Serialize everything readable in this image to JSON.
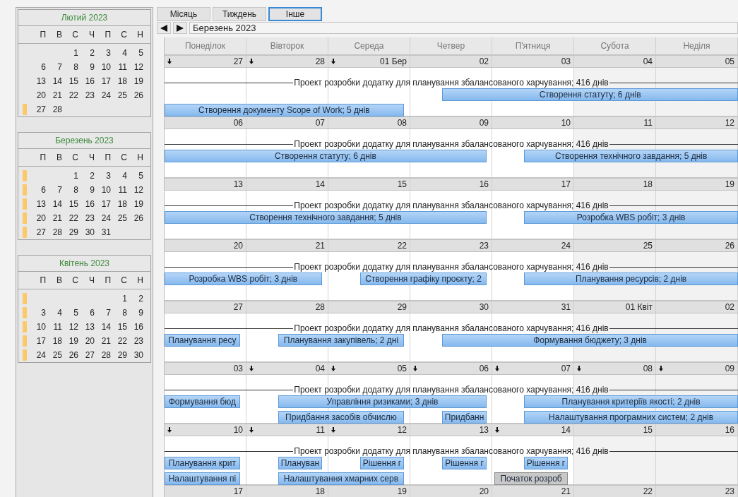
{
  "view_tabs": [
    {
      "label": "Місяць",
      "selected": false
    },
    {
      "label": "Тиждень",
      "selected": false
    },
    {
      "label": "Інше",
      "selected": true
    }
  ],
  "nav": {
    "title": "Березень 2023"
  },
  "mini_calendars": [
    {
      "title": "Лютий 2023",
      "weekdays": [
        "П",
        "В",
        "С",
        "Ч",
        "П",
        "С",
        "Н"
      ],
      "weeks": [
        {
          "marked": false,
          "days": [
            "1",
            "2",
            "3",
            "4",
            "5"
          ]
        },
        {
          "marked": false,
          "days": [
            "6",
            "7",
            "8",
            "9",
            "10",
            "11",
            "12"
          ]
        },
        {
          "marked": false,
          "days": [
            "13",
            "14",
            "15",
            "16",
            "17",
            "18",
            "19"
          ]
        },
        {
          "marked": false,
          "days": [
            "20",
            "21",
            "22",
            "23",
            "24",
            "25",
            "26"
          ]
        },
        {
          "marked": true,
          "days": [
            "27",
            "28"
          ]
        }
      ]
    },
    {
      "title": "Березень 2023",
      "weekdays": [
        "П",
        "В",
        "С",
        "Ч",
        "П",
        "С",
        "Н"
      ],
      "weeks": [
        {
          "marked": true,
          "days": [
            "1",
            "2",
            "3",
            "4",
            "5"
          ]
        },
        {
          "marked": true,
          "days": [
            "6",
            "7",
            "8",
            "9",
            "10",
            "11",
            "12"
          ]
        },
        {
          "marked": true,
          "days": [
            "13",
            "14",
            "15",
            "16",
            "17",
            "18",
            "19"
          ]
        },
        {
          "marked": true,
          "days": [
            "20",
            "21",
            "22",
            "23",
            "24",
            "25",
            "26"
          ]
        },
        {
          "marked": true,
          "days": [
            "27",
            "28",
            "29",
            "30",
            "31"
          ]
        }
      ]
    },
    {
      "title": "Квітень 2023",
      "weekdays": [
        "П",
        "В",
        "С",
        "Ч",
        "П",
        "С",
        "Н"
      ],
      "weeks": [
        {
          "marked": true,
          "days": [
            "1",
            "2"
          ]
        },
        {
          "marked": true,
          "days": [
            "3",
            "4",
            "5",
            "6",
            "7",
            "8",
            "9"
          ]
        },
        {
          "marked": true,
          "days": [
            "10",
            "11",
            "12",
            "13",
            "14",
            "15",
            "16"
          ]
        },
        {
          "marked": true,
          "days": [
            "17",
            "18",
            "19",
            "20",
            "21",
            "22",
            "23"
          ]
        },
        {
          "marked": true,
          "days": [
            "24",
            "25",
            "26",
            "27",
            "28",
            "29",
            "30"
          ]
        }
      ]
    }
  ],
  "calendar": {
    "weekdays": [
      "Понеділок",
      "Вівторок",
      "Середа",
      "Четвер",
      "П'ятниця",
      "Субота",
      "Неділя"
    ],
    "weeks": [
      {
        "days": [
          {
            "label": "27",
            "flag": true
          },
          {
            "label": "28",
            "flag": true
          },
          {
            "label": "01 Бер",
            "flag": true
          },
          {
            "label": "02",
            "flag": false
          },
          {
            "label": "03",
            "flag": false
          },
          {
            "label": "04",
            "flag": false
          },
          {
            "label": "05",
            "flag": false
          }
        ],
        "summary": "Проект розробки додатку для планування збалансованого харчування; 416 днів",
        "lanes": [
          [
            {
              "text": "Створення статуту; 6 днів",
              "kind": "task"
            }
          ],
          [
            {
              "text": "Створення документу Scope of Work; 5 днів",
              "kind": "task"
            }
          ]
        ]
      },
      {
        "days": [
          {
            "label": "06",
            "flag": false
          },
          {
            "label": "07",
            "flag": false
          },
          {
            "label": "08",
            "flag": false
          },
          {
            "label": "09",
            "flag": false
          },
          {
            "label": "10",
            "flag": false
          },
          {
            "label": "11",
            "flag": false
          },
          {
            "label": "12",
            "flag": false
          }
        ],
        "summary": "Проект розробки додатку для планування збалансованого харчування; 416 днів",
        "lanes": [
          [
            {
              "text": "Створення статуту; 6 днів",
              "kind": "task"
            },
            {
              "text": "Створення технічного завдання; 5 днів",
              "kind": "task"
            }
          ]
        ]
      },
      {
        "days": [
          {
            "label": "13",
            "flag": false
          },
          {
            "label": "14",
            "flag": false
          },
          {
            "label": "15",
            "flag": false
          },
          {
            "label": "16",
            "flag": false
          },
          {
            "label": "17",
            "flag": false
          },
          {
            "label": "18",
            "flag": false
          },
          {
            "label": "19",
            "flag": false
          }
        ],
        "summary": "Проект розробки додатку для планування збалансованого харчування; 416 днів",
        "lanes": [
          [
            {
              "text": "Створення технічного завдання; 5 днів",
              "kind": "task"
            },
            {
              "text": "Розробка WBS робіт; 3 днів",
              "kind": "task"
            }
          ]
        ]
      },
      {
        "days": [
          {
            "label": "20",
            "flag": false
          },
          {
            "label": "21",
            "flag": false
          },
          {
            "label": "22",
            "flag": false
          },
          {
            "label": "23",
            "flag": false
          },
          {
            "label": "24",
            "flag": false
          },
          {
            "label": "25",
            "flag": false
          },
          {
            "label": "26",
            "flag": false
          }
        ],
        "summary": "Проект розробки додатку для планування збалансованого харчування; 416 днів",
        "lanes": [
          [
            {
              "text": "Розробка WBS робіт; 3 днів",
              "kind": "task"
            },
            {
              "text": "Створення графіку проєкту; 2",
              "kind": "task"
            },
            {
              "text": "Планування ресурсів; 2 днів",
              "kind": "task"
            }
          ]
        ]
      },
      {
        "days": [
          {
            "label": "27",
            "flag": false
          },
          {
            "label": "28",
            "flag": false
          },
          {
            "label": "29",
            "flag": false
          },
          {
            "label": "30",
            "flag": false
          },
          {
            "label": "31",
            "flag": false
          },
          {
            "label": "01 Квіт",
            "flag": false
          },
          {
            "label": "02",
            "flag": false
          }
        ],
        "summary": "Проект розробки додатку для планування збалансованого харчування; 416 днів",
        "lanes": [
          [
            {
              "text": "Планування ресу",
              "kind": "task"
            },
            {
              "text": "Планування закупівель; 2 дні",
              "kind": "task"
            },
            {
              "text": "Формування бюджету; 3 днів",
              "kind": "task"
            }
          ]
        ]
      },
      {
        "days": [
          {
            "label": "03",
            "flag": false
          },
          {
            "label": "04",
            "flag": true
          },
          {
            "label": "05",
            "flag": true
          },
          {
            "label": "06",
            "flag": true
          },
          {
            "label": "07",
            "flag": true
          },
          {
            "label": "08",
            "flag": true
          },
          {
            "label": "09",
            "flag": true
          }
        ],
        "summary": "Проект розробки додатку для планування збалансованого харчування; 416 днів",
        "lanes": [
          [
            {
              "text": "Формування бюд",
              "kind": "task"
            },
            {
              "text": "Управління ризиками; 3 днів",
              "kind": "task"
            },
            {
              "text": "Планування критеріїв якості; 2 днів",
              "kind": "task"
            }
          ],
          [
            {
              "text": "Придбання засобів обчислю",
              "kind": "task"
            },
            {
              "text": "Придбанн",
              "kind": "task"
            },
            {
              "text": "Налаштування програмних систем; 2 днів",
              "kind": "task"
            }
          ]
        ]
      },
      {
        "days": [
          {
            "label": "10",
            "flag": true
          },
          {
            "label": "11",
            "flag": true
          },
          {
            "label": "12",
            "flag": true
          },
          {
            "label": "13",
            "flag": false
          },
          {
            "label": "14",
            "flag": true
          },
          {
            "label": "15",
            "flag": false
          },
          {
            "label": "16",
            "flag": false
          }
        ],
        "summary": "Проект розробки додатку для планування збалансованого харчування; 416 днів",
        "lanes": [
          [
            {
              "text": "Планування крит",
              "kind": "task"
            },
            {
              "text": "Плануван",
              "kind": "task"
            },
            {
              "text": "Рішення г",
              "kind": "task"
            },
            {
              "text": "Рішення г",
              "kind": "task"
            },
            {
              "text": "Рішення г",
              "kind": "task"
            }
          ],
          [
            {
              "text": "Налаштування пі",
              "kind": "task"
            },
            {
              "text": "Налаштування хмарних серв",
              "kind": "task"
            },
            {
              "text": "Початок розроб",
              "kind": "inactive"
            }
          ]
        ]
      },
      {
        "days": [
          {
            "label": "17",
            "flag": false
          },
          {
            "label": "18",
            "flag": false
          },
          {
            "label": "19",
            "flag": false
          },
          {
            "label": "20",
            "flag": false
          },
          {
            "label": "21",
            "flag": false
          },
          {
            "label": "22",
            "flag": false
          },
          {
            "label": "23",
            "flag": false
          }
        ]
      }
    ]
  }
}
